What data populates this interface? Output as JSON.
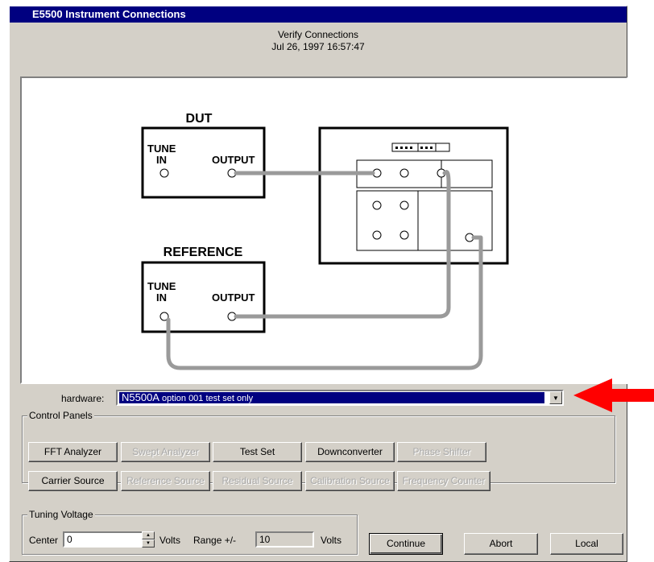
{
  "window": {
    "title": "E5500 Instrument Connections"
  },
  "header": {
    "line1": "Verify Connections",
    "line2": "Jul 26, 1997 16:57:47"
  },
  "diagram": {
    "dut_label": "DUT",
    "reference_label": "REFERENCE",
    "tune_label": "TUNE",
    "in_label": "IN",
    "output_label": "OUTPUT"
  },
  "hardware": {
    "label": "hardware:",
    "value_model": "N5500A",
    "value_rest": " option 001 test set only"
  },
  "control_panels": {
    "title": "Control Panels",
    "row1": [
      {
        "label": "FFT Analyzer",
        "enabled": true
      },
      {
        "label": "Swept Analyzer",
        "enabled": false
      },
      {
        "label": "Test Set",
        "enabled": true
      },
      {
        "label": "Downconverter",
        "enabled": true
      },
      {
        "label": "Phase Shifter",
        "enabled": false
      }
    ],
    "row2": [
      {
        "label": "Carrier Source",
        "enabled": true
      },
      {
        "label": "Reference Source",
        "enabled": false
      },
      {
        "label": "Residual Source",
        "enabled": false
      },
      {
        "label": "Calibration Source",
        "enabled": false
      },
      {
        "label": "Frequency Counter",
        "enabled": false
      }
    ]
  },
  "tuning": {
    "title": "Tuning Voltage",
    "center_label": "Center",
    "center_value": "0",
    "volts_label": "Volts",
    "range_label": "Range +/-",
    "range_value": "10",
    "volts_label2": "Volts"
  },
  "actions": {
    "continue": "Continue",
    "abort": "Abort",
    "local": "Local"
  },
  "colors": {
    "titlebar": "#000080",
    "arrow": "#ff0000",
    "cable": "#9a9a9a"
  }
}
